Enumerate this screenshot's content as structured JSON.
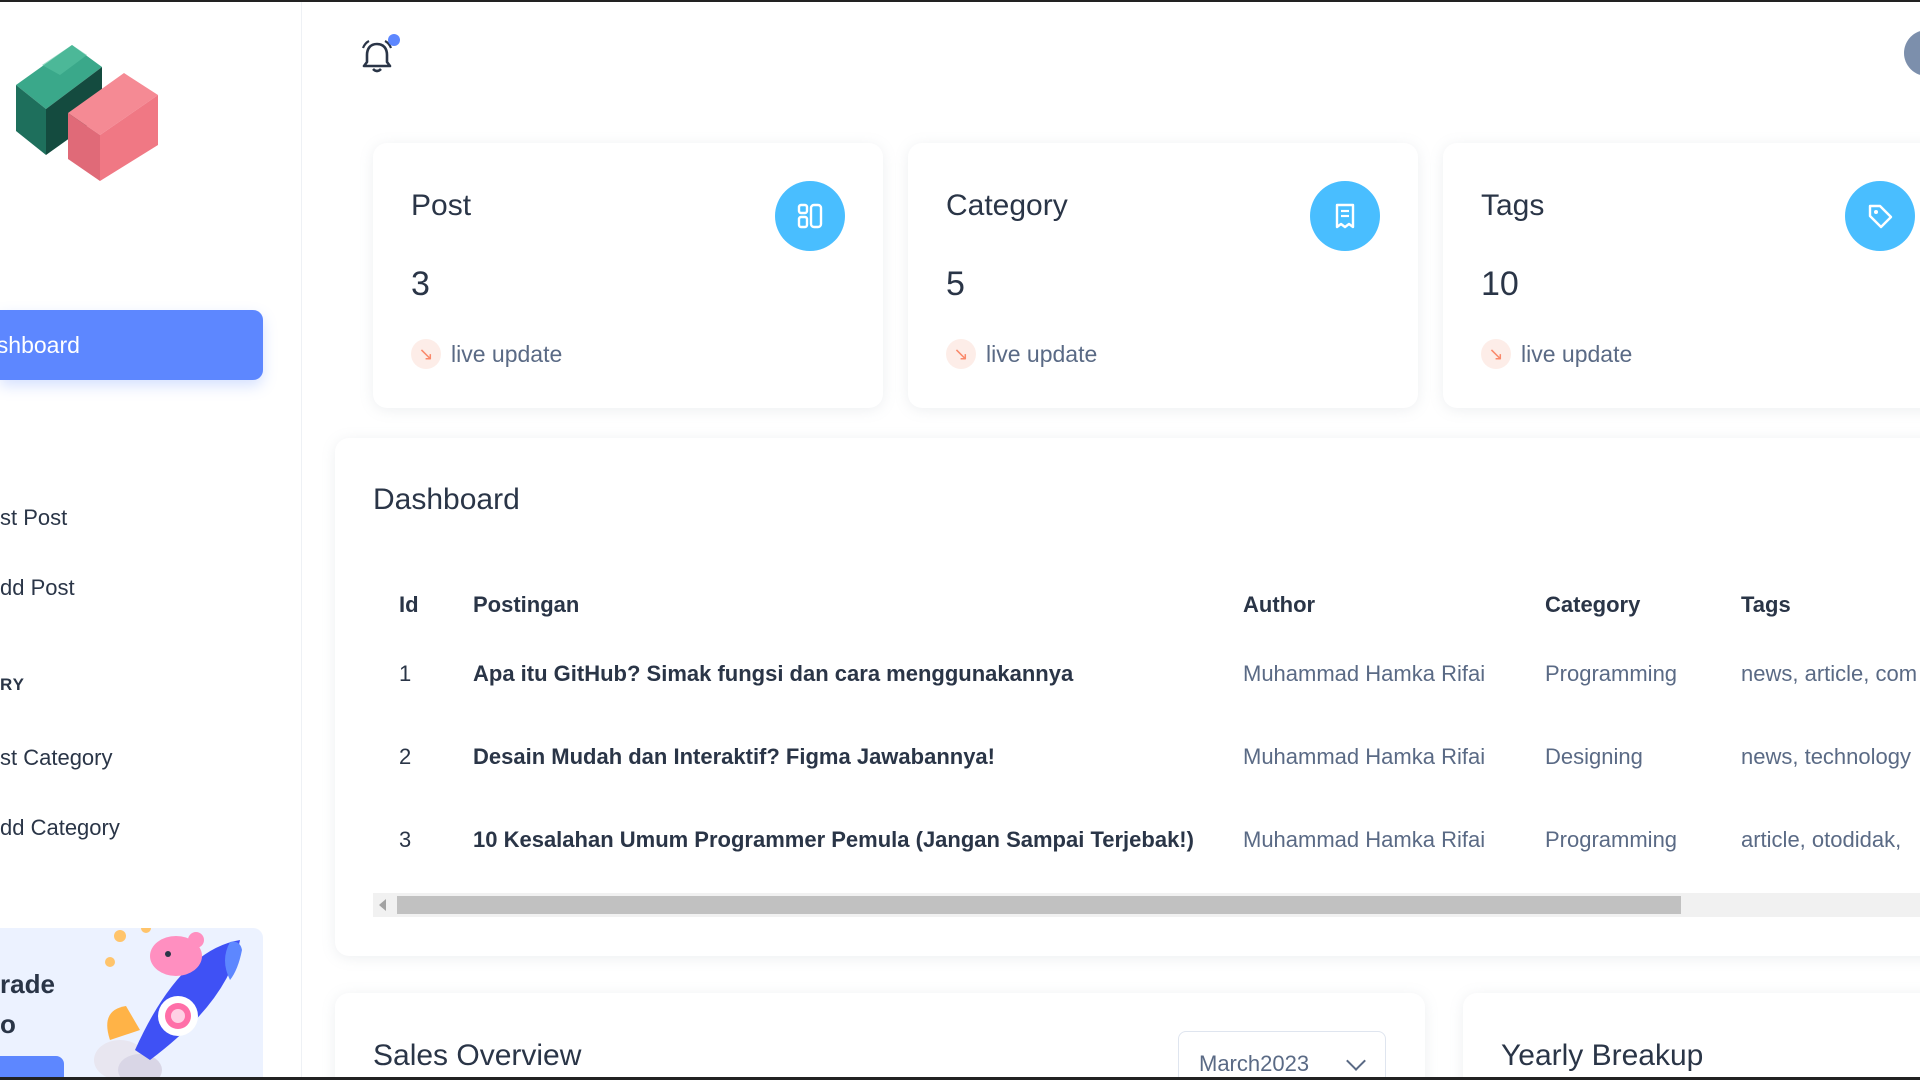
{
  "sidebar": {
    "active_item": "ashboard",
    "items": [
      {
        "label": "st Post"
      },
      {
        "label": "dd Post"
      },
      {
        "label": "RY"
      },
      {
        "label": "st Category"
      },
      {
        "label": "dd Category"
      }
    ],
    "upgrade": {
      "line1": "rade",
      "line2": "o"
    }
  },
  "stats": [
    {
      "title": "Post",
      "value": "3",
      "trend": "live update",
      "icon": "grid-icon"
    },
    {
      "title": "Category",
      "value": "5",
      "trend": "live update",
      "icon": "document-icon"
    },
    {
      "title": "Tags",
      "value": "10",
      "trend": "live update",
      "icon": "tag-icon"
    }
  ],
  "table": {
    "title": "Dashboard",
    "columns": [
      "Id",
      "Postingan",
      "Author",
      "Category",
      "Tags"
    ],
    "rows": [
      {
        "id": "1",
        "post": "Apa itu GitHub? Simak fungsi dan cara menggunakannya",
        "author": "Muhammad Hamka Rifai",
        "category": "Programming",
        "tags": "news, article, com"
      },
      {
        "id": "2",
        "post": "Desain Mudah dan Interaktif? Figma Jawabannya!",
        "author": "Muhammad Hamka Rifai",
        "category": "Designing",
        "tags": "news, technology"
      },
      {
        "id": "3",
        "post": "10 Kesalahan Umum Programmer Pemula (Jangan Sampai Terjebak!)",
        "author": "Muhammad Hamka Rifai",
        "category": "Programming",
        "tags": "article, otodidak,"
      }
    ]
  },
  "sales": {
    "title": "Sales Overview",
    "month": "March2023"
  },
  "yearly": {
    "title": "Yearly Breakup"
  },
  "colors": {
    "primary": "#5d87ff",
    "secondary": "#49beff",
    "text": "#2a3547",
    "muted": "#5a6a85",
    "trend_bg": "#fdede8",
    "trend_fg": "#fa896b"
  }
}
